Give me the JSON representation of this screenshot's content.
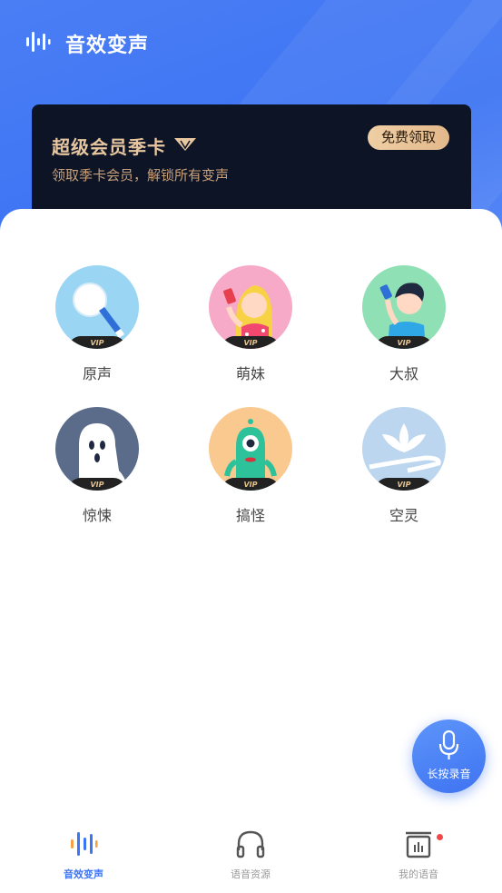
{
  "header": {
    "title": "音效变声",
    "icon": "waveform-icon"
  },
  "vip_card": {
    "title": "超级会员季卡",
    "subtitle": "领取季卡会员，解锁所有变声",
    "button": "免费领取",
    "badge_text": "VIP"
  },
  "effects": [
    {
      "label": "原声",
      "icon": "microphone-icon",
      "bg": "#9ad6f3",
      "vip": true
    },
    {
      "label": "萌妹",
      "icon": "girl-icon",
      "bg": "#f7a9c8",
      "vip": true
    },
    {
      "label": "大叔",
      "icon": "man-icon",
      "bg": "#8fe0b4",
      "vip": true
    },
    {
      "label": "惊悚",
      "icon": "ghost-icon",
      "bg": "#5a6c8a",
      "vip": true
    },
    {
      "label": "搞怪",
      "icon": "monster-icon",
      "bg": "#f9c990",
      "vip": true
    },
    {
      "label": "空灵",
      "icon": "lotus-icon",
      "bg": "#bcd6ef",
      "vip": true
    }
  ],
  "record_button": {
    "label": "长按录音",
    "icon": "microphone-icon"
  },
  "tabbar": {
    "tabs": [
      {
        "label": "音效变声",
        "icon": "waveform-icon",
        "active": true
      },
      {
        "label": "语音资源",
        "icon": "headphones-icon",
        "active": false
      },
      {
        "label": "我的语音",
        "icon": "audio-box-icon",
        "active": false,
        "badge_dot": true
      }
    ]
  },
  "colors": {
    "primary": "#3d74f3",
    "gold": "#e8c7a0",
    "card_bg": "#0d1426",
    "dot": "#f04848"
  }
}
